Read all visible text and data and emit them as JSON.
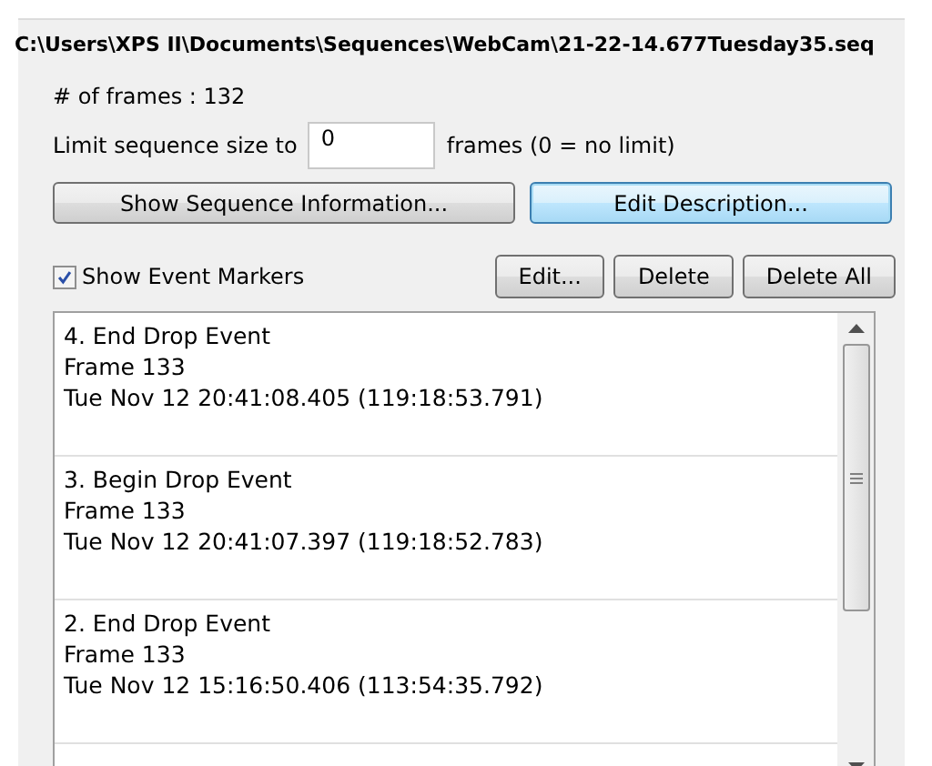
{
  "file_path": "C:\\Users\\XPS II\\Documents\\Sequences\\WebCam\\21-22-14.677Tuesday35.seq",
  "frame_count": "# of frames : 132",
  "limit": {
    "label": "Limit sequence size to",
    "value": "0",
    "suffix": "frames (0 = no limit)"
  },
  "buttons": [
    {
      "label": "Show Sequence Information...",
      "focused": false
    },
    {
      "label": "Edit Description...",
      "focused": true
    }
  ],
  "show_event_markers": {
    "label": "Show Event Markers",
    "checked": true
  },
  "event_buttons": [
    "Edit...",
    "Delete",
    "Delete All"
  ],
  "events": [
    {
      "title": "4. End Drop Event",
      "frame": "Frame 133",
      "time": "Tue Nov 12 20:41:08.405 (119:18:53.791)"
    },
    {
      "title": "3. Begin Drop Event",
      "frame": "Frame 133",
      "time": "Tue Nov 12 20:41:07.397 (119:18:52.783)"
    },
    {
      "title": "2. End Drop Event",
      "frame": "Frame 133",
      "time": "Tue Nov 12 15:16:50.406 (113:54:35.792)"
    }
  ]
}
